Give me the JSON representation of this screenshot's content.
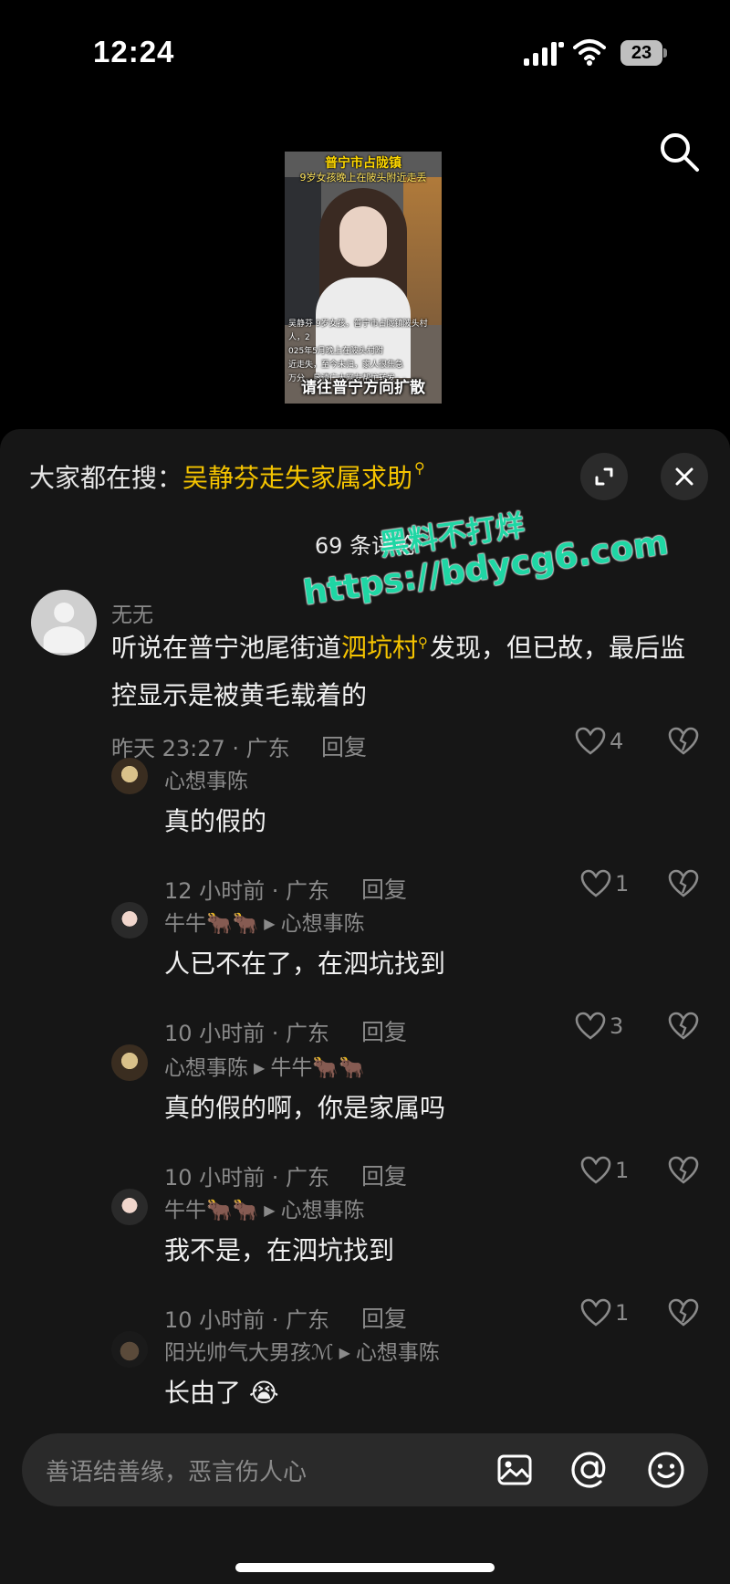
{
  "status_bar": {
    "time": "12:24",
    "battery": "23",
    "icons": [
      "signal-icon",
      "wifi-icon",
      "battery-icon"
    ]
  },
  "video": {
    "title_line1": "普宁市占陇镇",
    "title_line2": "9岁女孩晚上在陂头附近走丢",
    "body_lines": [
      "吴静芬 9岁女孩，普宁市占陇镇陂头村人，2",
      "025年5月晚上在陂头村附",
      "近走失，至今未归，家人很焦急",
      "万分，恳请广大网友帮忙转发"
    ],
    "caption": "请往普宁方向扩散"
  },
  "sheet": {
    "search_prefix": "大家都在搜：",
    "search_keyword": "吴静芬走失家属求助",
    "comment_count": "69 条评论",
    "watermark_line1": "黑料不打烊",
    "watermark_line2": "https://bdycg6.com",
    "input_placeholder": "善语结善缘，恶言伤人心"
  },
  "comments": [
    {
      "user": "无无",
      "text_before": "听说在普宁池尾街道",
      "highlight": "泗坑村",
      "text_after": "发现，但已故，最后监控显示是被黄毛载着的",
      "meta": "昨天 23:27 · 广东",
      "reply_label": "回复",
      "likes": "4"
    },
    {
      "user": "心想事陈",
      "text": "真的假的",
      "meta": "12 小时前 · 广东",
      "reply_label": "回复",
      "likes": "1"
    },
    {
      "user": "牛牛🐂🐂",
      "reply_to": "心想事陈",
      "text": "人已不在了，在泗坑找到",
      "meta": "10 小时前 · 广东",
      "reply_label": "回复",
      "likes": "3"
    },
    {
      "user": "心想事陈",
      "reply_to": "牛牛🐂🐂",
      "text": "真的假的啊，你是家属吗",
      "meta": "10 小时前 · 广东",
      "reply_label": "回复",
      "likes": "1"
    },
    {
      "user": "牛牛🐂🐂",
      "reply_to": "心想事陈",
      "text": "我不是，在泗坑找到",
      "meta": "10 小时前 · 广东",
      "reply_label": "回复",
      "likes": "1"
    },
    {
      "user": "阳光帅气大男孩ℳ",
      "reply_to": "心想事陈",
      "text": "长由了 😭"
    }
  ],
  "colors": {
    "background": "#000000",
    "sheet": "#161616",
    "accent": "#f5c400",
    "watermark": "#1fd6a4",
    "muted": "#8a8a8a"
  }
}
